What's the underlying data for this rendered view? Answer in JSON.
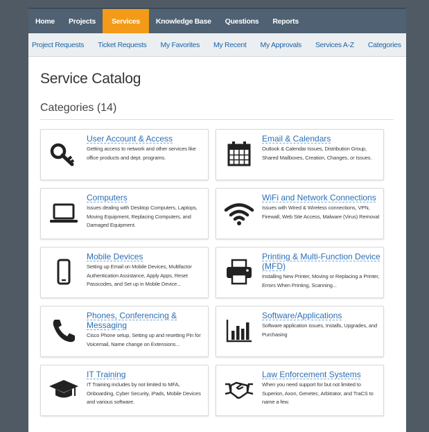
{
  "nav": {
    "items": [
      {
        "label": "Home",
        "active": false
      },
      {
        "label": "Projects",
        "active": false
      },
      {
        "label": "Services",
        "active": true
      },
      {
        "label": "Knowledge Base",
        "active": false
      },
      {
        "label": "Questions",
        "active": false
      },
      {
        "label": "Reports",
        "active": false
      }
    ]
  },
  "subnav": {
    "items": [
      "Project Requests",
      "Ticket Requests",
      "My Favorites",
      "My Recent",
      "My Approvals",
      "Services A-Z",
      "Categories"
    ]
  },
  "page": {
    "title": "Service Catalog",
    "section_title": "Categories (14)"
  },
  "categories": [
    {
      "title": "User Account & Access",
      "desc": "Getting access to network and other services like office products and dept. programs.",
      "icon": "key-icon"
    },
    {
      "title": "Email & Calendars",
      "desc": "Outlook & Calendar Issues, Distribution Group, Shared Mailboxes, Creation, Changes, or Issues.",
      "icon": "calendar-icon"
    },
    {
      "title": "Computers",
      "desc": "Issues dealing with Desktop Computers, Laptops, Moving Equipment, Replacing Computers, and Damaged Equipment.",
      "icon": "laptop-icon"
    },
    {
      "title": "WiFi and Network Connections",
      "desc": "Issues with Wired & Wireless connections, VPN, Firewall, Web Site Access, Malware (Virus) Removal",
      "icon": "wifi-icon"
    },
    {
      "title": "Mobile Devices",
      "desc": "Setting up Email on Mobile Devices, Multifactor Authentication Assistance, Apply Apps, Reset Passcodes, and Set up in Mobile Device...",
      "icon": "mobile-phone-icon"
    },
    {
      "title": "Printing & Multi-Function Device (MFD)",
      "desc": "Installing New Printer, Moving or Replacing a Printer, Errors When Printing, Scanning...",
      "icon": "printer-icon"
    },
    {
      "title": "Phones, Conferencing & Messaging",
      "desc": "Cisco Phone setup, Setting up and resetting Pin for Voicemail, Name change on Extensions...",
      "icon": "phone-handset-icon"
    },
    {
      "title": "Software/Applications",
      "desc": "Software application issues, Installs, Upgrades, and Purchasing",
      "icon": "bar-chart-icon"
    },
    {
      "title": "IT Training",
      "desc": "IT Training includes by not limited to MFA, Onboarding, Cyber Security, iPads, Mobile Devices and various software.",
      "icon": "graduation-cap-icon"
    },
    {
      "title": "Law Enforcement Systems",
      "desc": "When you need support for but not limited to Superion, Axon, Genetec, Arbitrator, and TraCS to name a few.",
      "icon": "handshake-icon"
    }
  ]
}
